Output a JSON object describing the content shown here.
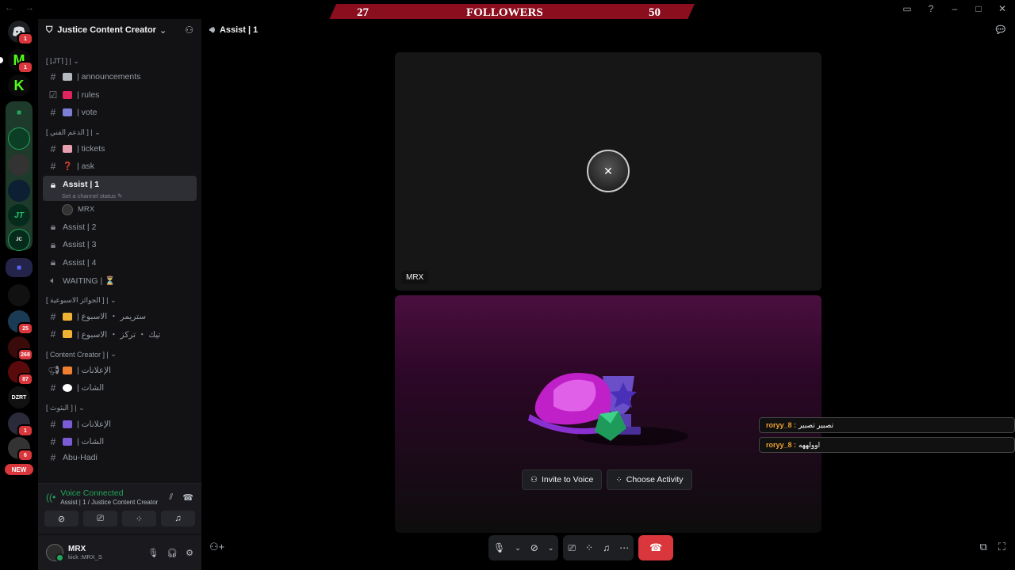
{
  "followers_banner": {
    "count_left": "27",
    "label": "FOLLOWERS",
    "count_right": "50"
  },
  "server": {
    "name": "Justice Content Creator"
  },
  "rail": {
    "badges": [
      "1",
      "1",
      "25",
      "268",
      "87",
      "1",
      "6"
    ],
    "server_abbrevs": [
      "DZRT"
    ],
    "new_label": "NEW"
  },
  "channels": {
    "cat1": "[ ⌊JT⌉ ] |",
    "announcements": "| announcements",
    "rules": "| rules",
    "vote": "| vote",
    "cat2": "[ الدعم الفني ] |",
    "tickets": "| tickets",
    "ask": "| ask",
    "assist1": "Assist | 1",
    "assist1_status": "Set a channel status",
    "voice_user": "MRX",
    "assist2": "Assist | 2",
    "assist3": "Assist | 3",
    "assist4": "Assist | 4",
    "waiting": "WAITING | ⏳",
    "cat3": "[ الجوائز الاسبوعية ] |",
    "weekly1": "| ستريمر ・ الاسبوع",
    "weekly2": "| تيك ・ تركز ・ الاسبوع",
    "cat4": "[ Content Creator ] |",
    "cc_announce": "| الإعلانات",
    "cc_chat": "| الشات",
    "cat5": "[ البثوث ] |",
    "bt_announce": "| الإعلانات",
    "bt_chat": "| الشات",
    "abu": "Abu-Hadi"
  },
  "voice_panel": {
    "status": "Voice Connected",
    "location": "Assist | 1 / Justice Content Creator"
  },
  "user_panel": {
    "name": "MRX",
    "status": "kick :MRX_S"
  },
  "main": {
    "header_title": "Assist | 1",
    "tile_label": "MRX",
    "invite_btn": "Invite to Voice",
    "activity_btn": "Choose Activity"
  },
  "overlay_chat": [
    {
      "user": "roryy_8 :",
      "msg": "تصبير تصبير"
    },
    {
      "user": "roryy_8 :",
      "msg": "اوولههه"
    }
  ]
}
